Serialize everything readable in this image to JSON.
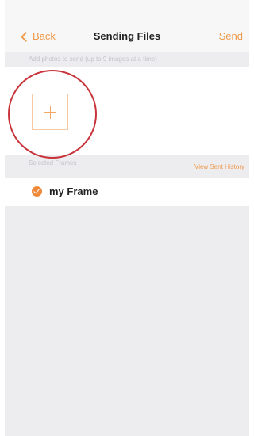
{
  "nav": {
    "back_label": "Back",
    "title": "Sending Files",
    "send_label": "Send"
  },
  "hint": "Add photos to send (up to 9 images at a time)",
  "frames_section": {
    "label": "Selected Frames",
    "history_link": "View Sent History"
  },
  "frames": [
    {
      "name": "my Frame",
      "selected": true
    }
  ],
  "colors": {
    "accent": "#f09a4b",
    "highlight_circle": "#c8343a",
    "background": "#ededf0"
  },
  "icons": {
    "back": "chevron-left-icon",
    "add": "plus-icon",
    "selected": "checkmark-circle-icon"
  }
}
